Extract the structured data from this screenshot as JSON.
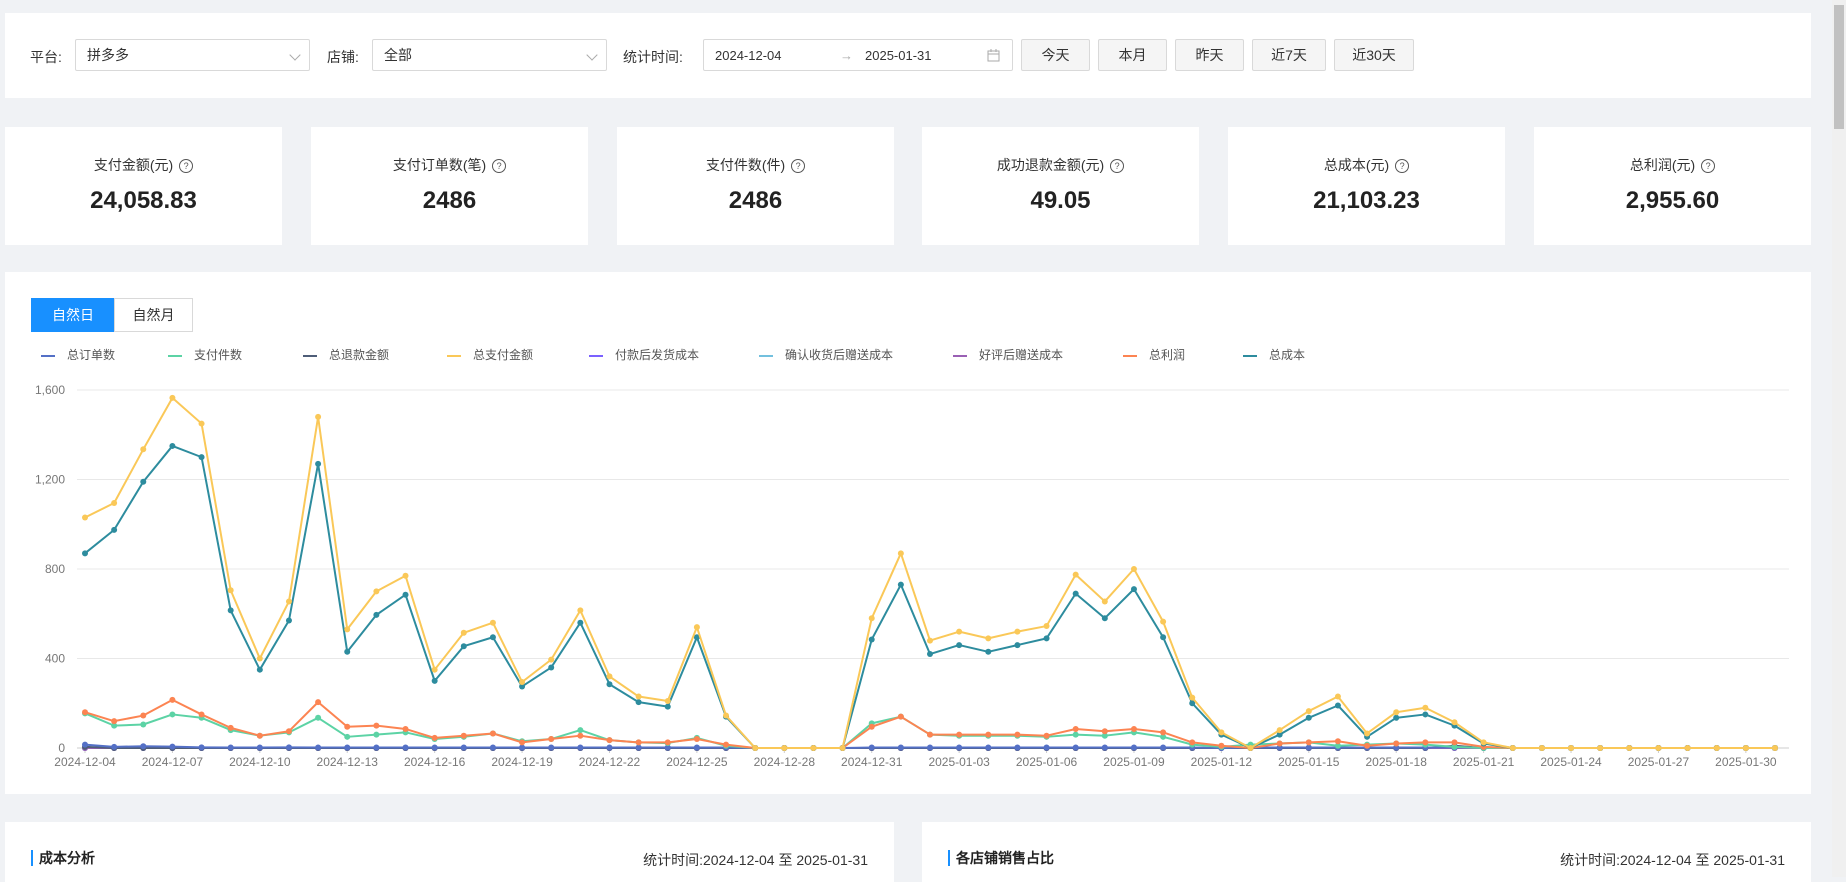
{
  "filters": {
    "platform_label": "平台:",
    "platform_value": "拼多多",
    "shop_label": "店铺:",
    "shop_value": "全部",
    "date_label": "统计时间:",
    "date_start": "2024-12-04",
    "date_end": "2025-01-31",
    "buttons": [
      "今天",
      "本月",
      "昨天",
      "近7天",
      "近30天"
    ]
  },
  "metrics": [
    {
      "label": "支付金额(元)",
      "value": "24,058.83"
    },
    {
      "label": "支付订单数(笔)",
      "value": "2486"
    },
    {
      "label": "支付件数(件)",
      "value": "2486"
    },
    {
      "label": "成功退款金额(元)",
      "value": "49.05"
    },
    {
      "label": "总成本(元)",
      "value": "21,103.23"
    },
    {
      "label": "总利润(元)",
      "value": "2,955.60"
    }
  ],
  "chart_tabs": [
    "自然日",
    "自然月"
  ],
  "chart_data": {
    "type": "line",
    "x": [
      "2024-12-04",
      "2024-12-05",
      "2024-12-06",
      "2024-12-07",
      "2024-12-08",
      "2024-12-09",
      "2024-12-10",
      "2024-12-11",
      "2024-12-12",
      "2024-12-13",
      "2024-12-14",
      "2024-12-15",
      "2024-12-16",
      "2024-12-17",
      "2024-12-18",
      "2024-12-19",
      "2024-12-20",
      "2024-12-21",
      "2024-12-22",
      "2024-12-23",
      "2024-12-24",
      "2024-12-25",
      "2024-12-26",
      "2024-12-27",
      "2024-12-28",
      "2024-12-29",
      "2024-12-30",
      "2024-12-31",
      "2025-01-01",
      "2025-01-02",
      "2025-01-03",
      "2025-01-04",
      "2025-01-05",
      "2025-01-06",
      "2025-01-07",
      "2025-01-08",
      "2025-01-09",
      "2025-01-10",
      "2025-01-11",
      "2025-01-12",
      "2025-01-13",
      "2025-01-14",
      "2025-01-15",
      "2025-01-16",
      "2025-01-17",
      "2025-01-18",
      "2025-01-19",
      "2025-01-20",
      "2025-01-21",
      "2025-01-22",
      "2025-01-23",
      "2025-01-24",
      "2025-01-25",
      "2025-01-26",
      "2025-01-27",
      "2025-01-28",
      "2025-01-29",
      "2025-01-30",
      "2025-01-31"
    ],
    "xticks": [
      "2024-12-04",
      "2024-12-07",
      "2024-12-10",
      "2024-12-13",
      "2024-12-16",
      "2024-12-19",
      "2024-12-22",
      "2024-12-25",
      "2024-12-28",
      "2024-12-31",
      "2025-01-03",
      "2025-01-06",
      "2025-01-09",
      "2025-01-12",
      "2025-01-15",
      "2025-01-18",
      "2025-01-21",
      "2025-01-24",
      "2025-01-27",
      "2025-01-30"
    ],
    "yticks": [
      0,
      400,
      800,
      1200,
      1600
    ],
    "ylim": [
      0,
      1600
    ],
    "grid": true,
    "legend_position": "top-left",
    "series": [
      {
        "name": "总订单数",
        "color": "#5470c6",
        "values": [
          15,
          5,
          8,
          6,
          3,
          2,
          2,
          3,
          2,
          2,
          2,
          2,
          2,
          2,
          2,
          2,
          2,
          2,
          2,
          2,
          2,
          2,
          2,
          0,
          0,
          0,
          0,
          2,
          2,
          2,
          2,
          2,
          2,
          2,
          2,
          2,
          2,
          2,
          2,
          0,
          2,
          2,
          2,
          2,
          2,
          2,
          2,
          2,
          2,
          0,
          0,
          0,
          0,
          0,
          0,
          0,
          0,
          0,
          0
        ]
      },
      {
        "name": "支付件数",
        "color": "#5cd3a5",
        "values": [
          155,
          100,
          105,
          150,
          135,
          80,
          55,
          70,
          135,
          50,
          60,
          70,
          40,
          50,
          65,
          30,
          40,
          80,
          35,
          25,
          22,
          45,
          10,
          0,
          0,
          0,
          0,
          110,
          140,
          60,
          55,
          55,
          55,
          50,
          60,
          55,
          70,
          50,
          15,
          5,
          15,
          20,
          25,
          10,
          15,
          20,
          15,
          5,
          0,
          0,
          0,
          0,
          0,
          0,
          0,
          0,
          0,
          0,
          0
        ]
      },
      {
        "name": "总退款金额",
        "color": "#4e5d78",
        "values": [
          5,
          0,
          0,
          0,
          0,
          0,
          0,
          0,
          0,
          0,
          0,
          0,
          0,
          0,
          0,
          0,
          0,
          0,
          0,
          0,
          0,
          0,
          0,
          0,
          0,
          0,
          0,
          0,
          0,
          0,
          0,
          0,
          0,
          0,
          0,
          0,
          0,
          0,
          0,
          0,
          0,
          0,
          0,
          0,
          0,
          0,
          0,
          10,
          0,
          0,
          0,
          0,
          0,
          0,
          0,
          0,
          0,
          0,
          0
        ]
      },
      {
        "name": "总支付金额",
        "color": "#fac858",
        "values": [
          1030,
          1095,
          1335,
          1565,
          1450,
          705,
          400,
          655,
          1480,
          530,
          700,
          770,
          350,
          515,
          560,
          295,
          395,
          615,
          320,
          230,
          210,
          540,
          145,
          0,
          0,
          0,
          0,
          580,
          870,
          480,
          520,
          490,
          520,
          545,
          775,
          655,
          800,
          565,
          225,
          70,
          0,
          80,
          165,
          230,
          65,
          160,
          180,
          115,
          25,
          0,
          0,
          0,
          0,
          0,
          0,
          0,
          0,
          0,
          0
        ]
      },
      {
        "name": "付款后发货成本",
        "color": "#7b61ff",
        "values": [
          0,
          0,
          0,
          0,
          0,
          0,
          0,
          0,
          0,
          0,
          0,
          0,
          0,
          0,
          0,
          0,
          0,
          0,
          0,
          0,
          0,
          0,
          0,
          0,
          0,
          0,
          0,
          0,
          0,
          0,
          0,
          0,
          0,
          0,
          0,
          0,
          0,
          0,
          0,
          0,
          0,
          0,
          0,
          0,
          0,
          0,
          0,
          0,
          0,
          0,
          0,
          0,
          0,
          0,
          0,
          0,
          0,
          0,
          0
        ]
      },
      {
        "name": "确认收货后赠送成本",
        "color": "#73c0de",
        "values": [
          0,
          0,
          0,
          0,
          0,
          0,
          0,
          0,
          0,
          0,
          0,
          0,
          0,
          0,
          0,
          0,
          0,
          0,
          0,
          0,
          0,
          0,
          0,
          0,
          0,
          0,
          0,
          0,
          0,
          0,
          0,
          0,
          0,
          0,
          0,
          0,
          0,
          0,
          0,
          0,
          0,
          0,
          0,
          0,
          0,
          0,
          0,
          0,
          0,
          0,
          0,
          0,
          0,
          0,
          0,
          0,
          0,
          0,
          0
        ]
      },
      {
        "name": "好评后赠送成本",
        "color": "#9a60b4",
        "values": [
          0,
          0,
          0,
          0,
          0,
          0,
          0,
          0,
          0,
          0,
          0,
          0,
          0,
          0,
          0,
          0,
          0,
          0,
          0,
          0,
          0,
          0,
          0,
          0,
          0,
          0,
          0,
          0,
          0,
          0,
          0,
          0,
          0,
          0,
          0,
          0,
          0,
          0,
          0,
          0,
          0,
          0,
          0,
          0,
          0,
          0,
          0,
          0,
          0,
          0,
          0,
          0,
          0,
          0,
          0,
          0,
          0,
          0,
          0
        ]
      },
      {
        "name": "总利润",
        "color": "#fc8452",
        "values": [
          160,
          120,
          145,
          215,
          150,
          90,
          55,
          75,
          205,
          95,
          100,
          85,
          45,
          55,
          65,
          25,
          40,
          55,
          35,
          25,
          25,
          40,
          15,
          0,
          0,
          0,
          0,
          95,
          140,
          60,
          60,
          60,
          60,
          55,
          85,
          75,
          85,
          70,
          25,
          10,
          0,
          20,
          25,
          30,
          10,
          20,
          25,
          25,
          5,
          0,
          0,
          0,
          0,
          0,
          0,
          0,
          0,
          0,
          0
        ]
      },
      {
        "name": "总成本",
        "color": "#2d8c9e",
        "values": [
          870,
          975,
          1190,
          1350,
          1300,
          615,
          350,
          570,
          1270,
          430,
          595,
          685,
          300,
          455,
          495,
          275,
          360,
          560,
          285,
          205,
          185,
          495,
          140,
          0,
          0,
          0,
          0,
          485,
          730,
          420,
          460,
          430,
          460,
          490,
          690,
          580,
          710,
          495,
          200,
          60,
          0,
          60,
          135,
          190,
          50,
          135,
          150,
          100,
          20,
          0,
          0,
          0,
          0,
          0,
          0,
          0,
          0,
          0,
          0
        ]
      }
    ]
  },
  "bottom": {
    "cost_title": "成本分析",
    "cost_stat": "统计时间:2024-12-04 至 2025-01-31",
    "share_title": "各店铺销售占比",
    "share_stat": "统计时间:2024-12-04 至 2025-01-31"
  }
}
